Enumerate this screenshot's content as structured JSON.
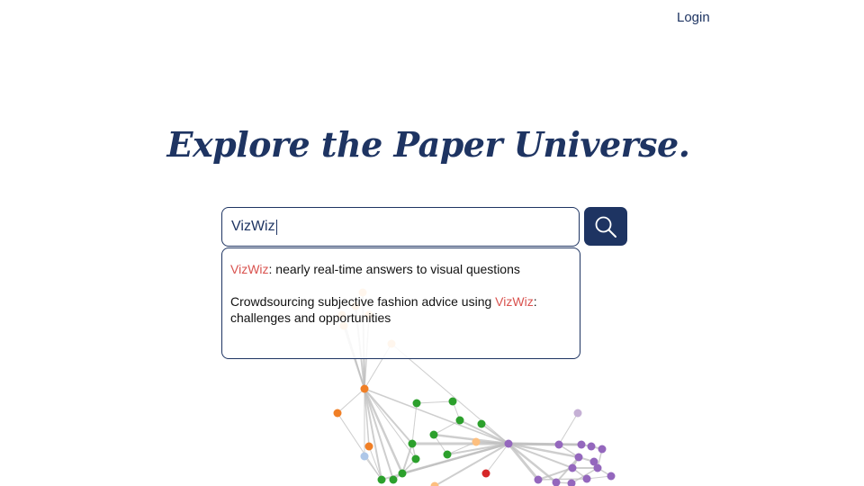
{
  "nav": {
    "login_label": "Login"
  },
  "hero": {
    "title": "Explore the Paper Universe."
  },
  "search": {
    "query": "VizWiz",
    "suggestions": [
      {
        "highlight": "VizWiz",
        "rest": ": nearly real-time answers to visual questions"
      },
      {
        "before": "Crowdsourcing subjective fashion advice using ",
        "highlight": "VizWiz",
        "after": ": challenges and opportunities"
      }
    ]
  },
  "colors": {
    "brand": "#1e3462",
    "highlight": "#d9534f",
    "node_orange": "#f07f26",
    "node_light_orange": "#fdbf7f",
    "node_green": "#2ca02c",
    "node_purple": "#9467bd",
    "node_light_purple": "#c5b0d5",
    "node_red": "#d62728",
    "node_light_blue": "#aec7e8"
  },
  "icons": {
    "search": "magnifier-icon"
  }
}
